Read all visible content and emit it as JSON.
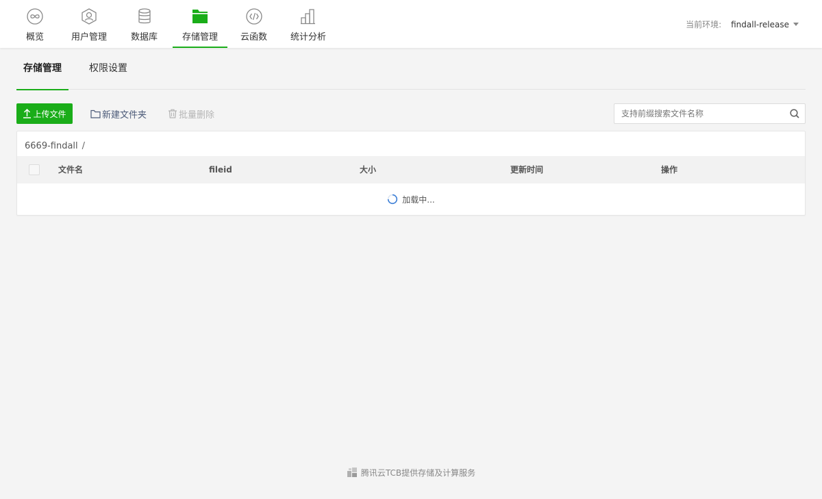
{
  "nav": {
    "items": [
      {
        "label": "概览",
        "icon": "overview-icon"
      },
      {
        "label": "用户管理",
        "icon": "user-icon"
      },
      {
        "label": "数据库",
        "icon": "database-icon"
      },
      {
        "label": "存储管理",
        "icon": "folder-icon",
        "active": true
      },
      {
        "label": "云函数",
        "icon": "function-icon"
      },
      {
        "label": "统计分析",
        "icon": "chart-icon"
      }
    ],
    "env_label": "当前环境:",
    "env_value": "findall-release"
  },
  "subtabs": [
    {
      "label": "存储管理",
      "active": true
    },
    {
      "label": "权限设置"
    }
  ],
  "toolbar": {
    "upload_label": "上传文件",
    "new_folder_label": "新建文件夹",
    "batch_delete_label": "批量删除",
    "search_placeholder": "支持前缀搜索文件名称"
  },
  "table": {
    "breadcrumb_root": "6669-findall",
    "breadcrumb_sep": "/",
    "columns": [
      "文件名",
      "fileid",
      "大小",
      "更新时间",
      "操作"
    ],
    "loading_text": "加载中..."
  },
  "footer": {
    "text": "腾讯云TCB提供存储及计算服务"
  },
  "colors": {
    "accent": "#1aad19",
    "background": "#f4f4f4"
  }
}
